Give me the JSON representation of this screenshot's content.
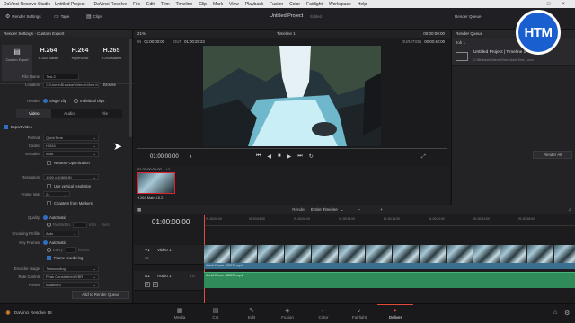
{
  "app": {
    "title": "DaVinci Resolve Studio - Untitled Project",
    "menu": [
      "DaVinci Resolve",
      "File",
      "Edit",
      "Trim",
      "Timeline",
      "Clip",
      "Mark",
      "View",
      "Playback",
      "Fusion",
      "Color",
      "Fairlight",
      "Workspace",
      "Help"
    ],
    "window_controls": [
      "–",
      "□",
      "×"
    ]
  },
  "toolbar": {
    "render_settings": "Render Settings",
    "tape": "Tape",
    "clips": "Clips",
    "project_title": "Untitled Project",
    "edited": "Edited",
    "render_queue": "Render Queue"
  },
  "render_settings": {
    "header": "Render Settings - Custom Export",
    "presets": [
      {
        "big": "",
        "label": "Custom Export"
      },
      {
        "big": "H.264",
        "label": "H.264 Master"
      },
      {
        "big": "H.264",
        "label": "HyperDeck"
      },
      {
        "big": "H.265",
        "label": "H.265 Master"
      }
    ],
    "filename_label": "File Name",
    "filename_value": "Test-2",
    "location_label": "Location",
    "location_value": "C:\\Users\\Bhaskar\\Videos\\View folder",
    "browse": "Browse",
    "render_label": "Render",
    "single_clip": "Single clip",
    "individual_clips": "Individual clips",
    "tabs": [
      "Video",
      "Audio",
      "File"
    ],
    "export_video": "Export Video",
    "format_label": "Format",
    "format_value": "QuickTime",
    "codec_label": "Codec",
    "codec_value": "H.264",
    "encoder_label": "Encoder",
    "encoder_value": "Auto",
    "network_opt": "Network Optimization",
    "resolution_label": "Resolution",
    "resolution_value": "1920 x 1080 HD",
    "vertical_res": "Use vertical resolution",
    "framerate_label": "Frame rate",
    "framerate_value": "24",
    "chapters": "Chapters from Markers",
    "quality_label": "Quality",
    "quality_auto": "Automatic",
    "quality_restrict": "Restrict to",
    "quality_kb": "Kb/s",
    "quality_best": "Best",
    "enc_profile_label": "Encoding Profile",
    "enc_profile_value": "Auto",
    "keyframes_label": "Key Frames",
    "keyframes_auto": "Automatic",
    "keyframes_every": "Every",
    "keyframes_frames": "frames",
    "frame_reorder": "Frame reordering",
    "encoder_usage_label": "Encoder usage",
    "encoder_usage_value": "Transcoding",
    "rate_control_label": "Rate Control",
    "rate_control_value": "Peak Constrained VBR",
    "preset_label": "Preset",
    "preset_value": "Balanced",
    "add_to_queue": "Add to Render Queue"
  },
  "viewer": {
    "zoom": "21%",
    "tc_in_label": "IN",
    "tc_in": "01:00:00:00",
    "tc_out_label": "OUT",
    "tc_out": "01:00:29:23",
    "timeline_name": "Timeline 1",
    "tc_right": "00:00:00:00",
    "duration_label": "DURATION",
    "duration": "00:00:40:00",
    "current_tc": "01:00:00:00"
  },
  "clip_bin": {
    "clip_tc": "01 01:00:00:00",
    "clip_codec": "V1",
    "clip_name": "H.264 Main L5.2"
  },
  "timeline": {
    "render_label": "Render",
    "render_value": "Entire Timeline",
    "tc": "01:00:00:00",
    "ruler": [
      "01:00:00:00",
      "01:00:04:00",
      "01:00:08:00",
      "01:00:12:00",
      "01:00:16:00",
      "01:00:20:00",
      "01:00:24:00",
      "01:00:28:00"
    ],
    "video_track_id": "V1",
    "video_track_name": "Video 1",
    "video_clip": "Aerial Drone - 85575.mp4",
    "audio_track_id": "A1",
    "audio_track_name": "Audio 1",
    "audio_level": "2.0",
    "audio_clip": "Aerial Drone - 85575.mp4"
  },
  "render_queue": {
    "header": "Render Queue",
    "job_label": "Job 1",
    "job_title": "Untitled Project | Timeline 1",
    "job_path": "C:\\Bhaskar\\Videos\\View folder\\Test-1.mov",
    "render_all": "Render All"
  },
  "bottom": {
    "app_name": "DaVinci Resolve 18",
    "pages": [
      {
        "icon": "▦",
        "label": "Media"
      },
      {
        "icon": "▤",
        "label": "Cut"
      },
      {
        "icon": "✎",
        "label": "Edit"
      },
      {
        "icon": "◈",
        "label": "Fusion"
      },
      {
        "icon": "◐",
        "label": "Color"
      },
      {
        "icon": "♪",
        "label": "Fairlight"
      },
      {
        "icon": "➤",
        "label": "Deliver"
      }
    ],
    "active_page": "Deliver"
  },
  "overlay": {
    "logo_text": "HTM"
  },
  "colors": {
    "accent": "#2f6fbf",
    "audio_clip": "#2f8c5a",
    "deliver_active": "#e04b3a"
  }
}
